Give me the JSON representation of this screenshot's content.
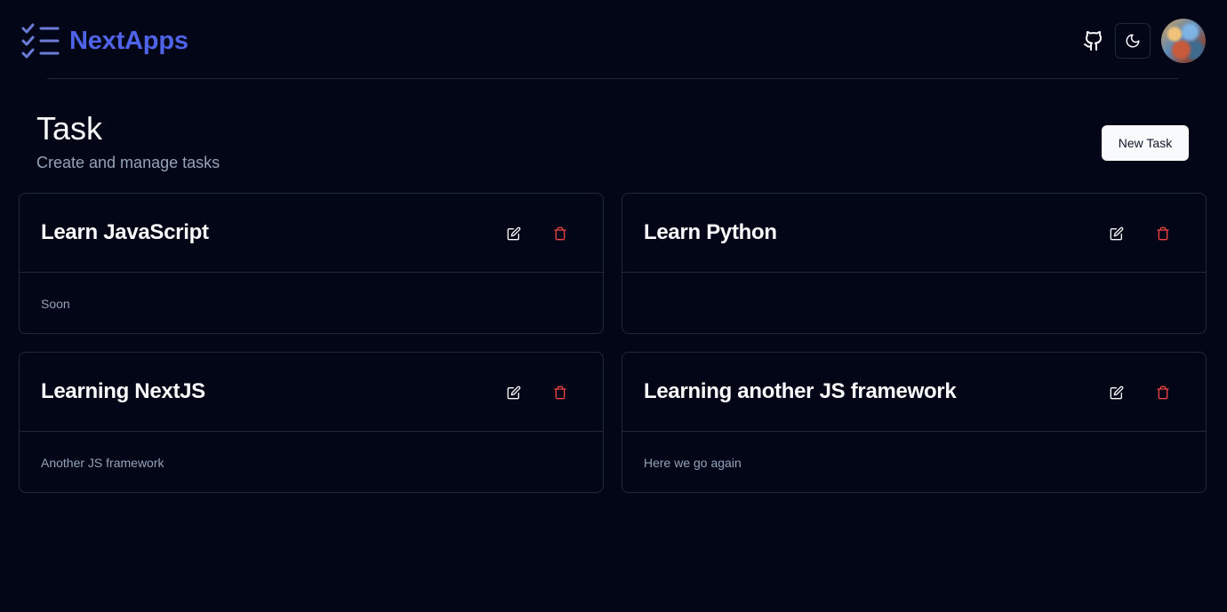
{
  "brand": {
    "name": "NextApps",
    "color": "#4f63e8",
    "icon": "checklist-icon"
  },
  "header": {
    "github_icon": "github-icon",
    "theme_icon": "moon-icon",
    "avatar": "user-avatar"
  },
  "page": {
    "title": "Task",
    "subtitle": "Create and manage tasks",
    "new_task_label": "New Task"
  },
  "tasks": [
    {
      "title": "Learn JavaScript",
      "description": "Soon"
    },
    {
      "title": "Learn Python",
      "description": ""
    },
    {
      "title": "Learning NextJS",
      "description": "Another JS framework"
    },
    {
      "title": "Learning another JS framework",
      "description": "Here we go again"
    }
  ],
  "colors": {
    "background": "#030617",
    "border": "#1e293b",
    "muted_text": "#94a3b8",
    "delete": "#ef4444"
  }
}
